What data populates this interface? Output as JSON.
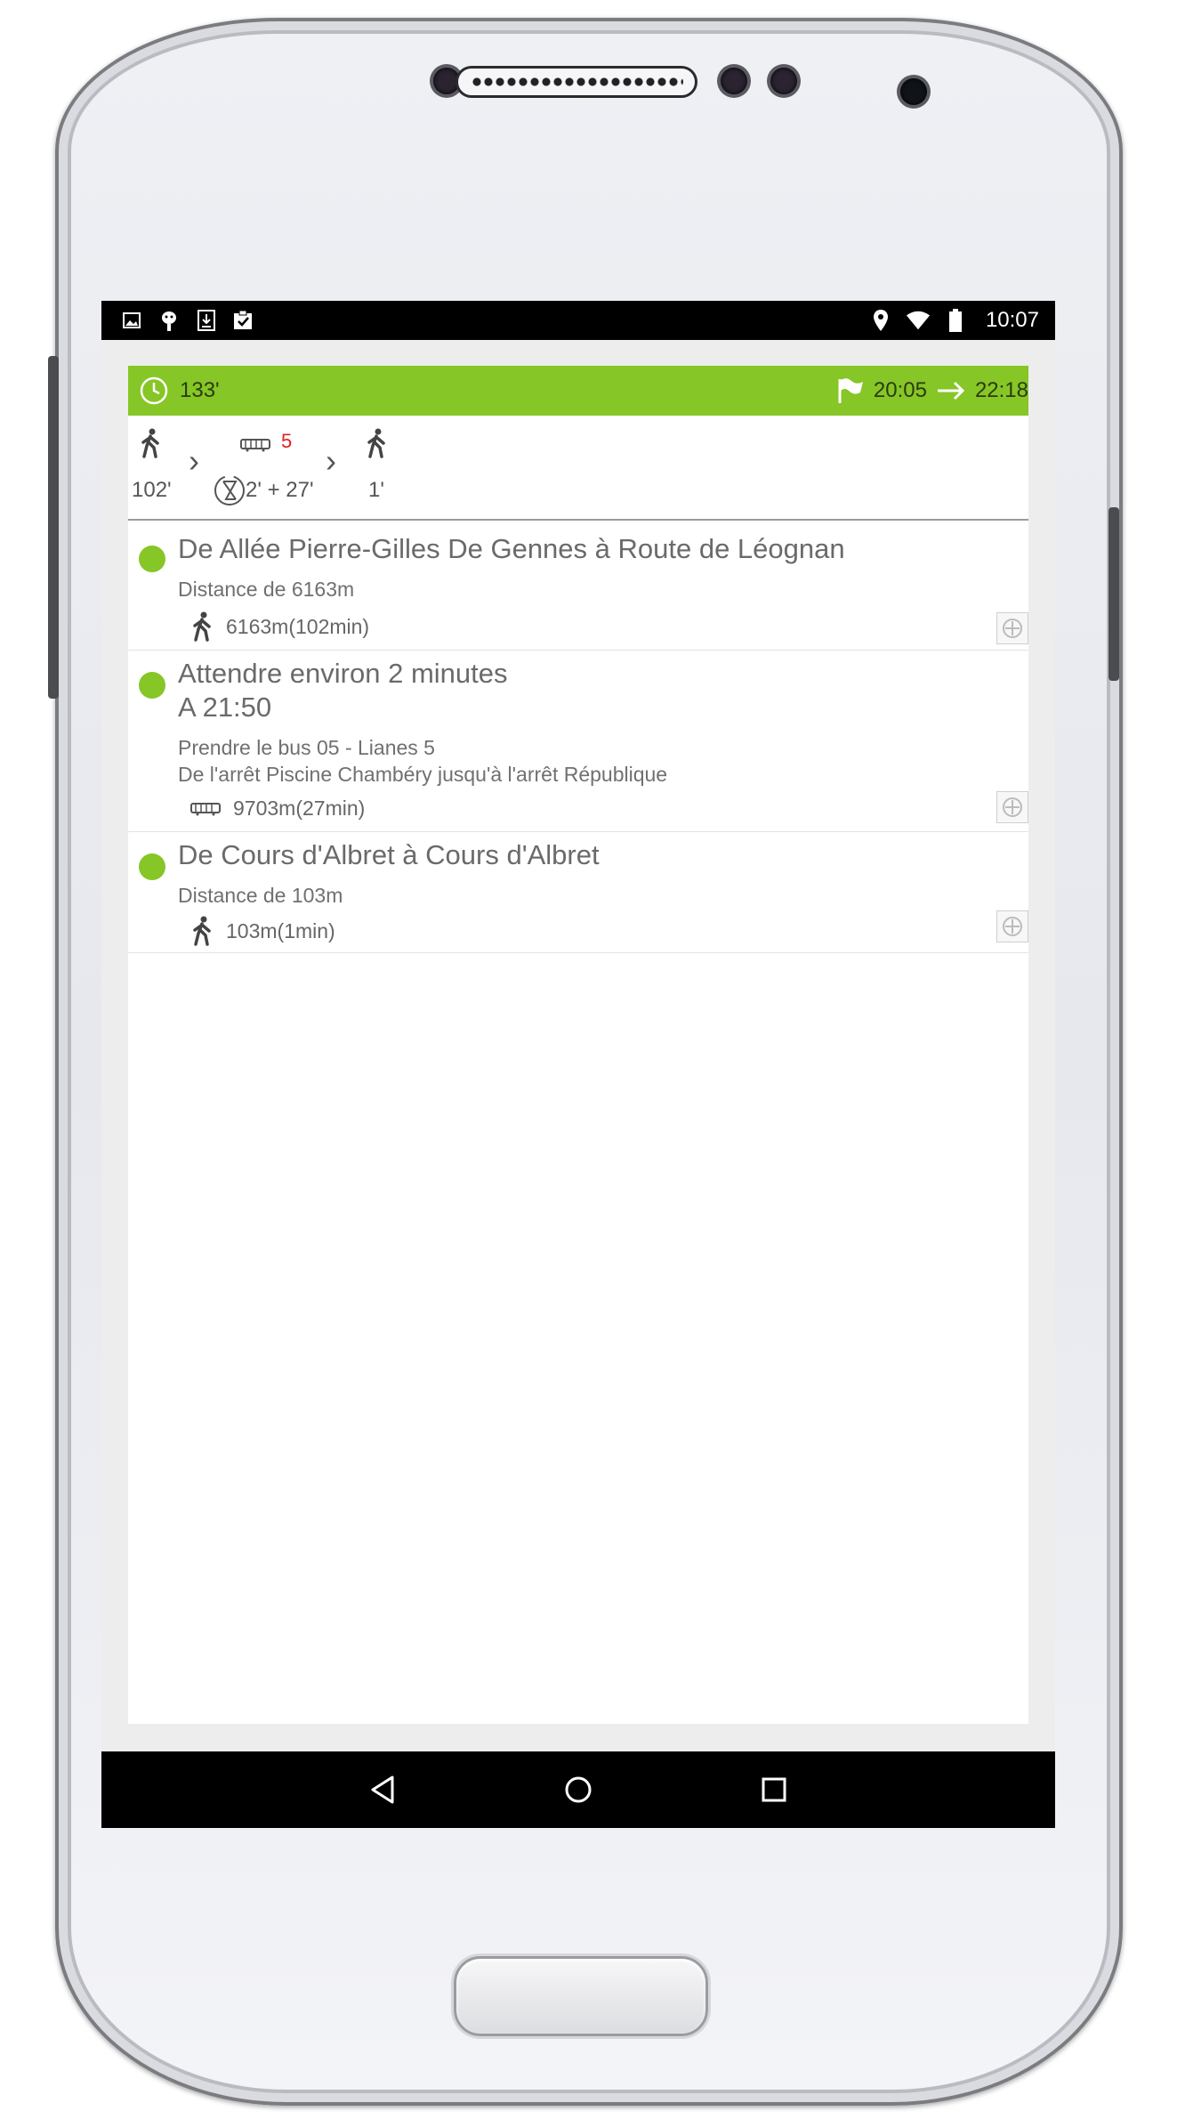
{
  "status_bar": {
    "time": "10:07",
    "left_icons": [
      "image-icon",
      "android-debug-icon",
      "download-icon",
      "clipboard-icon"
    ],
    "right_icons": [
      "location-icon",
      "wifi-icon",
      "battery-icon"
    ]
  },
  "summary": {
    "duration": "133'",
    "depart_time": "20:05",
    "arrive_time": "22:18",
    "color": "#86c626"
  },
  "modes": {
    "walk1": "102'",
    "bus_line": "5",
    "wait_and_ride": "2' + 27'",
    "walk2": "1'"
  },
  "steps": [
    {
      "title": "De Allée Pierre-Gilles De Gennes à Route de Léognan",
      "sub1": "Distance de 6163m",
      "metric": "6163m(102min)",
      "icon": "walk-icon"
    },
    {
      "title": "Attendre environ 2 minutes",
      "title2": "A 21:50",
      "sub1": "Prendre le bus 05 - Lianes 5",
      "sub2": "De l'arrêt Piscine Chambéry jusqu'à l'arrêt République",
      "metric": "9703m(27min)",
      "icon": "bus-icon"
    },
    {
      "title": "De Cours d'Albret à Cours d'Albret",
      "sub1": "Distance de 103m",
      "metric": "103m(1min)",
      "icon": "walk-icon"
    }
  ]
}
